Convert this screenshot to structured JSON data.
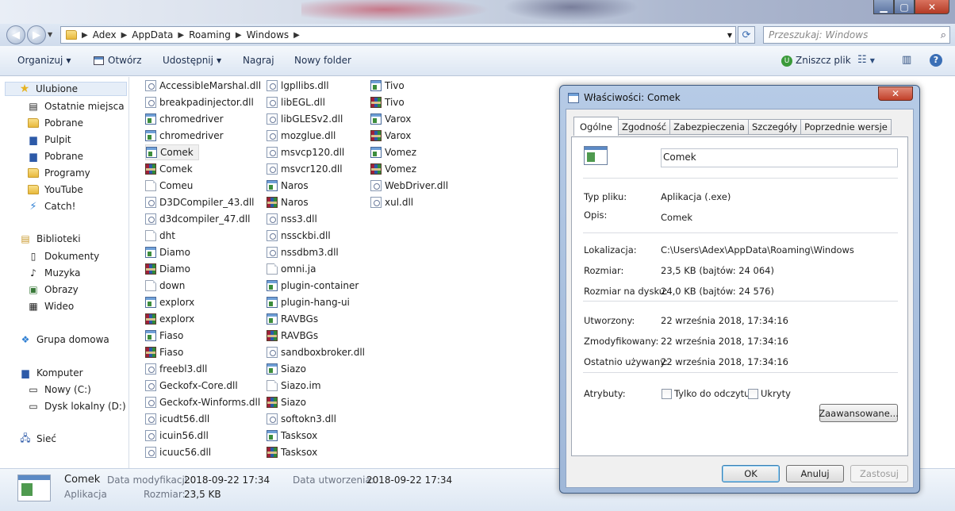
{
  "address": {
    "crumbs": [
      "Adex",
      "AppData",
      "Roaming",
      "Windows"
    ],
    "search_placeholder": "Przeszukaj: Windows"
  },
  "toolbar": {
    "organize": "Organizuj",
    "open": "Otwórz",
    "share": "Udostępnij",
    "burn": "Nagraj",
    "new_folder": "Nowy folder",
    "scan": "Zniszcz plik"
  },
  "sidebar": {
    "favorites": "Ulubione",
    "fav_items": [
      "Ostatnie miejsca",
      "Pobrane",
      "Pulpit",
      "Pobrane",
      "Programy",
      "YouTube",
      "Catch!"
    ],
    "libraries": "Biblioteki",
    "lib_items": [
      "Dokumenty",
      "Muzyka",
      "Obrazy",
      "Wideo"
    ],
    "homegroup": "Grupa domowa",
    "computer": "Komputer",
    "comp_items": [
      "Nowy (C:)",
      "Dysk lokalny (D:)"
    ],
    "network": "Sieć"
  },
  "files": {
    "col1": [
      {
        "name": "AccessibleMarshal.dll",
        "type": "dll"
      },
      {
        "name": "breakpadinjector.dll",
        "type": "dll"
      },
      {
        "name": "chromedriver",
        "type": "app"
      },
      {
        "name": "chromedriver",
        "type": "app"
      },
      {
        "name": "Comek",
        "type": "app"
      },
      {
        "name": "Comek",
        "type": "rar"
      },
      {
        "name": "Comeu",
        "type": "blank"
      },
      {
        "name": "D3DCompiler_43.dll",
        "type": "dll"
      },
      {
        "name": "d3dcompiler_47.dll",
        "type": "dll"
      },
      {
        "name": "dht",
        "type": "blank"
      },
      {
        "name": "Diamo",
        "type": "app"
      },
      {
        "name": "Diamo",
        "type": "rar"
      },
      {
        "name": "down",
        "type": "blank"
      },
      {
        "name": "explorx",
        "type": "app"
      },
      {
        "name": "explorx",
        "type": "rar"
      },
      {
        "name": "Fiaso",
        "type": "app"
      },
      {
        "name": "Fiaso",
        "type": "rar"
      },
      {
        "name": "freebl3.dll",
        "type": "dll"
      },
      {
        "name": "Geckofx-Core.dll",
        "type": "dll"
      },
      {
        "name": "Geckofx-Winforms.dll",
        "type": "dll"
      },
      {
        "name": "icudt56.dll",
        "type": "dll"
      },
      {
        "name": "icuin56.dll",
        "type": "dll"
      },
      {
        "name": "icuuc56.dll",
        "type": "dll"
      }
    ],
    "col2": [
      {
        "name": "lgpllibs.dll",
        "type": "dll"
      },
      {
        "name": "libEGL.dll",
        "type": "dll"
      },
      {
        "name": "libGLESv2.dll",
        "type": "dll"
      },
      {
        "name": "mozglue.dll",
        "type": "dll"
      },
      {
        "name": "msvcp120.dll",
        "type": "dll"
      },
      {
        "name": "msvcr120.dll",
        "type": "dll"
      },
      {
        "name": "Naros",
        "type": "app"
      },
      {
        "name": "Naros",
        "type": "rar"
      },
      {
        "name": "nss3.dll",
        "type": "dll"
      },
      {
        "name": "nssckbi.dll",
        "type": "dll"
      },
      {
        "name": "nssdbm3.dll",
        "type": "dll"
      },
      {
        "name": "omni.ja",
        "type": "blank"
      },
      {
        "name": "plugin-container",
        "type": "app"
      },
      {
        "name": "plugin-hang-ui",
        "type": "app"
      },
      {
        "name": "RAVBGs",
        "type": "app"
      },
      {
        "name": "RAVBGs",
        "type": "rar"
      },
      {
        "name": "sandboxbroker.dll",
        "type": "dll"
      },
      {
        "name": "Siazo",
        "type": "app"
      },
      {
        "name": "Siazo.im",
        "type": "blank"
      },
      {
        "name": "Siazo",
        "type": "rar"
      },
      {
        "name": "softokn3.dll",
        "type": "dll"
      },
      {
        "name": "Tasksox",
        "type": "app"
      },
      {
        "name": "Tasksox",
        "type": "rar"
      }
    ],
    "col3": [
      {
        "name": "Tivo",
        "type": "app"
      },
      {
        "name": "Tivo",
        "type": "rar"
      },
      {
        "name": "Varox",
        "type": "app"
      },
      {
        "name": "Varox",
        "type": "rar"
      },
      {
        "name": "Vomez",
        "type": "app"
      },
      {
        "name": "Vomez",
        "type": "rar"
      },
      {
        "name": "WebDriver.dll",
        "type": "dll"
      },
      {
        "name": "xul.dll",
        "type": "dll"
      }
    ]
  },
  "status": {
    "name": "Comek",
    "type": "Aplikacja",
    "modified_label": "Data modyfikacji:",
    "modified_value": "2018-09-22 17:34",
    "created_label": "Data utworzenia:",
    "created_value": "2018-09-22 17:34",
    "size_label": "Rozmiar:",
    "size_value": "23,5 KB"
  },
  "dialog": {
    "title": "Właściwości: Comek",
    "tabs": [
      "Ogólne",
      "Zgodność",
      "Zabezpieczenia",
      "Szczegóły",
      "Poprzednie wersje"
    ],
    "name_value": "Comek",
    "type_label": "Typ pliku:",
    "type_value": "Aplikacja (.exe)",
    "desc_label": "Opis:",
    "desc_value": "Comek",
    "loc_label": "Lokalizacja:",
    "loc_value": "C:\\Users\\Adex\\AppData\\Roaming\\Windows",
    "size_label": "Rozmiar:",
    "size_value": "23,5 KB (bajtów: 24 064)",
    "disk_label": "Rozmiar na dysku:",
    "disk_value": "24,0 KB (bajtów: 24 576)",
    "created_label": "Utworzony:",
    "created_value": "22 września 2018, 17:34:16",
    "modified_label": "Zmodyfikowany:",
    "modified_value": "22 września 2018, 17:34:16",
    "accessed_label": "Ostatnio używany:",
    "accessed_value": "22 września 2018, 17:34:16",
    "attr_label": "Atrybuty:",
    "readonly_label": "Tylko do odczytu",
    "hidden_label": "Ukryty",
    "advanced_label": "Zaawansowane...",
    "ok": "OK",
    "cancel": "Anuluj",
    "apply": "Zastosuj"
  }
}
